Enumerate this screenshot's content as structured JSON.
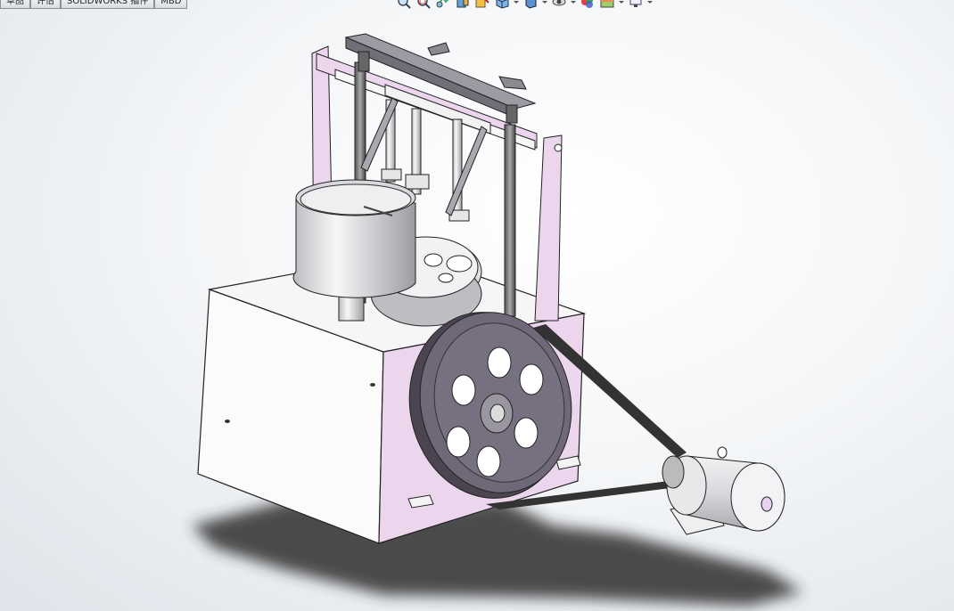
{
  "tabs": [
    "草图",
    "评估",
    "SOLIDWORKS 插件",
    "MBD"
  ],
  "toolbar": {
    "icons": [
      "zoom-to-fit-icon",
      "zoom-to-area-icon",
      "previous-view-icon",
      "section-view-icon",
      "dynamic-annotation-icon",
      "view-orientation-icon",
      "display-style-icon",
      "hide-show-items-icon",
      "edit-appearance-icon",
      "apply-scene-icon",
      "view-settings-icon"
    ]
  },
  "viewport": {
    "model": "pulley-driven-press-machine-assembly",
    "colors": {
      "accent_pink": "#e8d3ea",
      "pulley": "#6e6878",
      "metal": "#c9c9cd",
      "shadow": "#2b2b2b"
    }
  }
}
